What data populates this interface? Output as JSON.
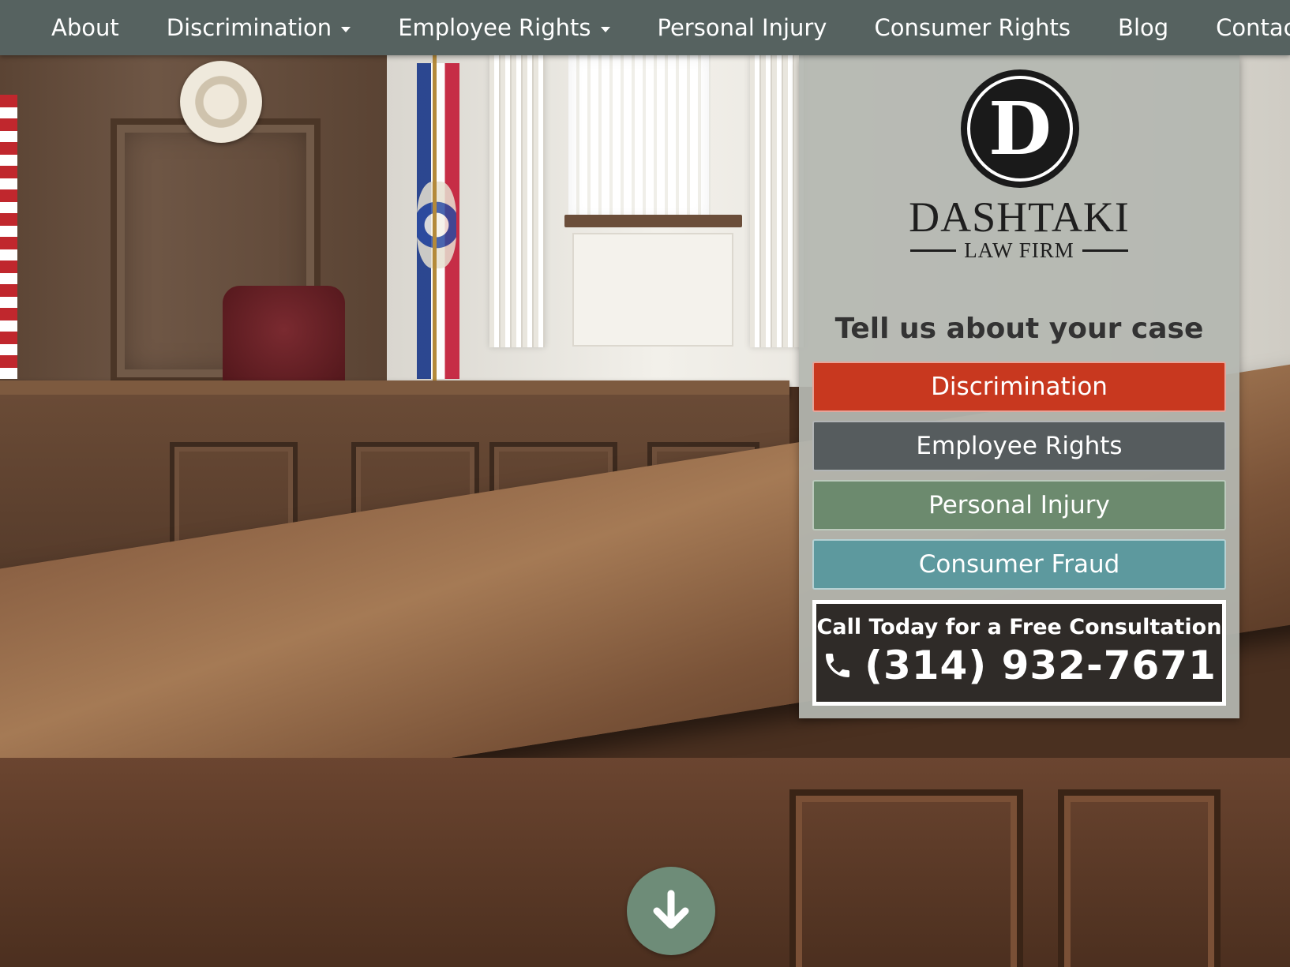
{
  "nav": {
    "items": [
      {
        "label": "About",
        "dropdown": false
      },
      {
        "label": "Discrimination",
        "dropdown": true
      },
      {
        "label": "Employee Rights",
        "dropdown": true
      },
      {
        "label": "Personal Injury",
        "dropdown": false
      },
      {
        "label": "Consumer Rights",
        "dropdown": false
      },
      {
        "label": "Blog",
        "dropdown": false
      },
      {
        "label": "Contact",
        "dropdown": false
      }
    ]
  },
  "logo": {
    "letter": "D",
    "name": "DASHTAKI",
    "subtitle": "LAW FIRM"
  },
  "case_panel": {
    "heading": "Tell us about your case",
    "buttons": [
      {
        "label": "Discrimination",
        "color": "#c8381f"
      },
      {
        "label": "Employee Rights",
        "color": "#565c5e"
      },
      {
        "label": "Personal Injury",
        "color": "#6c8a6e"
      },
      {
        "label": "Consumer Fraud",
        "color": "#5d999e"
      }
    ],
    "call": {
      "label": "Call Today for a Free Consultation",
      "phone": "(314) 932-7671",
      "icon": "phone-icon"
    }
  },
  "scroll": {
    "icon": "arrow-down-icon",
    "color": "#6e8c78"
  },
  "colors": {
    "nav_bg": "#566260",
    "panel_bg": "#b4b7b0"
  }
}
